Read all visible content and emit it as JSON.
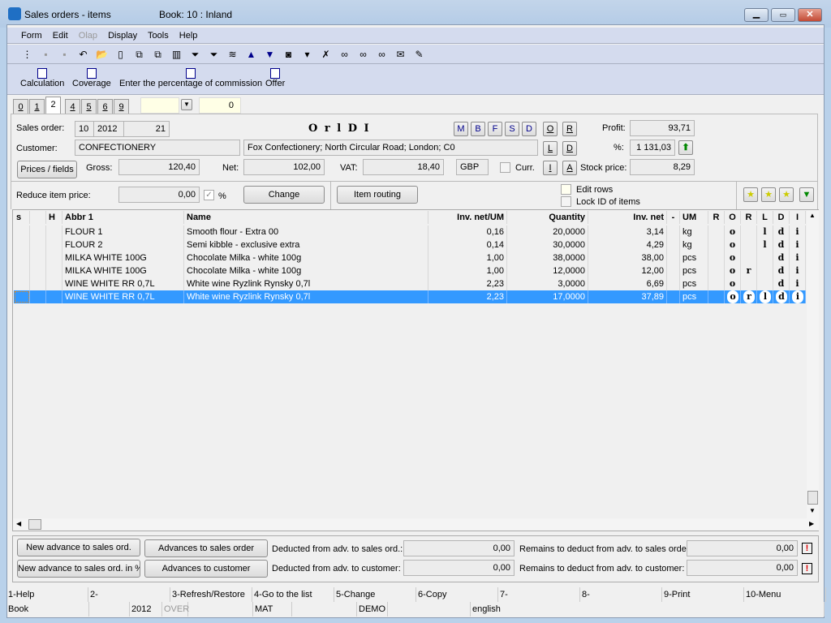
{
  "window": {
    "title": "Sales orders - items",
    "book": "Book: 10 : Inland"
  },
  "menu": [
    "Form",
    "Edit",
    "Olap",
    "Display",
    "Tools",
    "Help"
  ],
  "toolbar_icons": [
    "tree-icon",
    "save-icon",
    "save-as-icon",
    "undo-icon",
    "open-folder-icon",
    "new-document-icon",
    "copy-icon",
    "paste-icon",
    "book-icon",
    "filter-icon",
    "filter-document-icon",
    "money-icon",
    "arrow-up-icon",
    "arrow-down-icon",
    "camera-icon",
    "dropdown-icon",
    "excel-icon",
    "binoculars-icon",
    "binoculars-next-icon",
    "binoculars-prev-icon",
    "mail-icon",
    "edit-note-icon"
  ],
  "actions": [
    "Calculation",
    "Coverage",
    "Enter the percentage of commission",
    "Offer"
  ],
  "tabs": [
    "0",
    "1",
    "2",
    "4",
    "5",
    "6",
    "9"
  ],
  "active_tab": "2",
  "filter": {
    "combo": "",
    "value": "0"
  },
  "form": {
    "sales_order_label": "Sales order:",
    "so_book": "10",
    "so_year": "2012",
    "so_number": "21",
    "flags_text": "O r l D I",
    "customer_label": "Customer:",
    "customer": "CONFECTIONERY",
    "address": "Fox Confectionery; North Circular Road; London; C0",
    "prices_button": "Prices / fields",
    "gross_label": "Gross:",
    "gross": "120,40",
    "net_label": "Net:",
    "net": "102,00",
    "vat_label": "VAT:",
    "vat": "18,40",
    "currency": "GBP",
    "curr_label": "Curr.",
    "small_buttons": [
      "M",
      "B",
      "F",
      "S",
      "D"
    ],
    "side_buttons": [
      "O",
      "R",
      "L",
      "D",
      "I",
      "A"
    ],
    "profit_label": "Profit:",
    "profit": "93,71",
    "pct_label": "%:",
    "pct": "1 131,03",
    "stock_label": "Stock price:",
    "stock": "8,29",
    "reduce_label": "Reduce item price:",
    "reduce": "0,00",
    "pct_sign": "%",
    "change_button": "Change",
    "routing_button": "Item routing",
    "edit_rows": "Edit rows",
    "lock_id": "Lock ID of items"
  },
  "grid": {
    "columns": [
      "s",
      "",
      "H",
      "Abbr 1",
      "Name",
      "Inv. net/UM",
      "Quantity",
      "Inv. net",
      "-",
      "UM",
      "R",
      "O",
      "R",
      "L",
      "D",
      "I"
    ],
    "rows": [
      {
        "abbr": "FLOUR 1",
        "name": "Smooth flour - Extra 00",
        "price": "0,16",
        "qty": "20,0000",
        "net": "3,14",
        "um": "kg",
        "o": "o",
        "r": "",
        "l": "l",
        "d": "d",
        "i": "i"
      },
      {
        "abbr": "FLOUR 2",
        "name": "Semi kibble - exclusive extra",
        "price": "0,14",
        "qty": "30,0000",
        "net": "4,29",
        "um": "kg",
        "o": "o",
        "r": "",
        "l": "l",
        "d": "d",
        "i": "i"
      },
      {
        "abbr": "MILKA WHITE 100G",
        "name": "Chocolate Milka - white 100g",
        "price": "1,00",
        "qty": "38,0000",
        "net": "38,00",
        "um": "pcs",
        "o": "o",
        "r": "",
        "l": "",
        "d": "d",
        "i": "i"
      },
      {
        "abbr": "MILKA WHITE 100G",
        "name": "Chocolate Milka - white 100g",
        "price": "1,00",
        "qty": "12,0000",
        "net": "12,00",
        "um": "pcs",
        "o": "o",
        "r": "r",
        "l": "",
        "d": "d",
        "i": "i"
      },
      {
        "abbr": "WINE WHITE RR 0,7L",
        "name": "White wine Ryzlink Rynsky 0,7l",
        "price": "2,23",
        "qty": "3,0000",
        "net": "6,69",
        "um": "pcs",
        "o": "o",
        "r": "",
        "l": "",
        "d": "d",
        "i": "i"
      },
      {
        "abbr": "WINE WHITE RR 0,7L",
        "name": "White wine Ryzlink Rynsky 0,7l",
        "price": "2,23",
        "qty": "17,0000",
        "net": "37,89",
        "um": "pcs",
        "o": "o",
        "r": "r",
        "l": "l",
        "d": "d",
        "i": "i",
        "selected": true
      }
    ]
  },
  "advances": {
    "new_adv": "New advance to sales ord.",
    "new_adv_pct": "New advance to sales ord. in %",
    "adv_so": "Advances to sales order",
    "adv_cust": "Advances to customer",
    "ded_so_label": "Deducted from adv. to sales ord.:",
    "ded_so": "0,00",
    "ded_cust_label": "Deducted from adv. to customer:",
    "ded_cust": "0,00",
    "rem_so_label": "Remains to deduct from adv. to sales order:",
    "rem_so": "0,00",
    "rem_cust_label": "Remains to deduct from adv. to customer:",
    "rem_cust": "0,00"
  },
  "fkeys": [
    "1-Help",
    "2-",
    "3-Refresh/Restore",
    "4-Go to the list",
    "5-Change",
    "6-Copy",
    "7-",
    "8-",
    "9-Print",
    "10-Menu"
  ],
  "status": [
    "Book",
    "",
    "2012",
    "OVER",
    "",
    "MAT",
    "",
    "DEMO",
    "",
    "english"
  ]
}
